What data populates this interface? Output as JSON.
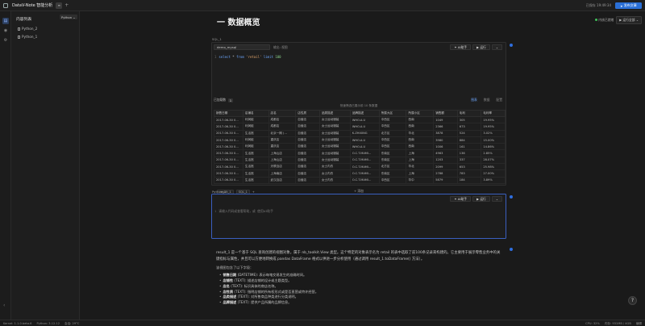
{
  "app": {
    "title": "DataV-Note 智能分析",
    "saved_text": "已保存 19:49:34",
    "publish_label": "发布文章",
    "tab_icon": "layers-icon"
  },
  "sidebar": {
    "title": "内容列表",
    "new_button": "Python",
    "items": [
      {
        "label": "Python_2"
      },
      {
        "label": "Python_1"
      }
    ]
  },
  "toolbar": {
    "kernel_status": "内核已就绪",
    "run_all": "运行全部"
  },
  "heading": {
    "text": "一 数据概览"
  },
  "sql_cell": {
    "label": "SQL_1",
    "db": "demo_mysql",
    "output_label": "输出: 视图",
    "ai_button": "AI助手",
    "run_button": "运行",
    "line_no": "1",
    "code": {
      "kw1": "select",
      "star": " * ",
      "kw2": "from",
      "table": " 'retail' ",
      "kw3": "limit",
      "limit": "100"
    },
    "result_label": "已加载数",
    "result_count": "1",
    "view_tabs": [
      "图表",
      "数据",
      "配置"
    ],
    "data_note": "快速筛选已展示前 10 条数据",
    "columns": [
      "销售日期",
      "店铺名",
      "店名",
      "店性质",
      "品类描述",
      "品牌描述",
      "所属大区",
      "所属小区",
      "销售额",
      "毛利",
      "毛利率"
    ],
    "rows": [
      [
        "2017-06-30 0...",
        "利润组",
        "成都店",
        "自营店",
        "女士运动服装",
        "WHO.A.U",
        "中西区",
        "西南",
        "1049",
        "305",
        "19.95%"
      ],
      [
        "2017-06-30 0...",
        "利润组",
        "成都店",
        "自营店",
        "女士运动服装",
        "WHO.A.U",
        "中西区",
        "西南",
        "2366",
        "673",
        "19.95%"
      ],
      [
        "2017-06-30 0...",
        "生活馆",
        "北京一期 (...",
        "自营店",
        "女士运动服装",
        "K.ZHIXING",
        "北方区",
        "华北",
        "3878",
        "524",
        "3.02%"
      ],
      [
        "2017-06-30 0...",
        "利润组",
        "重庆店",
        "自营店",
        "女士运动服装",
        "WHO.A.U",
        "中西区",
        "西南",
        "3980",
        "884",
        "15.00%"
      ],
      [
        "2017-06-30 0...",
        "利润组",
        "重庆店",
        "自营店",
        "女士运动服装",
        "WHO.A.U",
        "中西区",
        "西南",
        "1006",
        "161",
        "14.86%"
      ],
      [
        "2017-06-30 0...",
        "生活馆",
        "上海山店",
        "自营店",
        "女士运动服装",
        "O.C.T.MAMI...",
        "东南区",
        "上海",
        "4963",
        "136",
        "2.85%"
      ],
      [
        "2017-06-30 0...",
        "生活馆",
        "上海山店",
        "自营店",
        "女士运动服装",
        "O.C.T.MAMI...",
        "东南区",
        "上海",
        "1203",
        "337",
        "28.07%"
      ],
      [
        "2017-06-30 0...",
        "生活馆",
        "天联百店",
        "自营店",
        "女士内衣",
        "O.C.T.MAMI...",
        "北方区",
        "华北",
        "2099",
        "653",
        "25.98%"
      ],
      [
        "2017-06-30 0...",
        "生活馆",
        "上海南店",
        "自营店",
        "女士内衣",
        "O.C.T.MAMI...",
        "东南区",
        "上海",
        "2788",
        "783",
        "27.00%"
      ],
      [
        "2017-06-30 0...",
        "生活馆",
        "武汉百店",
        "自营店",
        "女士内衣",
        "O.C.T.MAMI...",
        "中西区",
        "华中",
        "5879",
        "184",
        "3.89%"
      ]
    ],
    "result_tabs": [
      "result_1",
      "SQL_1"
    ],
    "add_label": "+ 添加"
  },
  "python_cell": {
    "label": "Python_2",
    "ai_button": "AI助手",
    "run_button": "运行",
    "line_no": "1",
    "placeholder": "请输入代码或查看帮助，或 使用AI助手"
  },
  "markdown": {
    "para_a": "result_1 是一个基于 SQL 查询创建的视图对象，属于 nb_toolkit.View 类型。这个特定的对象表示名为 retail 的表中选取了前100条记录来构建的。它主要用于展示零售业务中的关键指标与属性，并且可以方便地转换成 pandas DataFrame 格式以供进一步分析使用（通过调用 result_1.toDataFrame() 方法）。",
    "sub": "该视图包含了以下字段：",
    "fields": [
      {
        "name": "销售日期",
        "desc": " (DATETIME): 表示每笔交易发生的准确时间。"
      },
      {
        "name": "店铺性",
        "desc": " (TEXT): 描述店铺的设计或主题类型。"
      },
      {
        "name": "店名",
        "desc": " (TEXT): 标识具体的商店名称。"
      },
      {
        "name": "店性质",
        "desc": " (TEXT): 指明店铺的所有权形式或是否直营或特许经营。"
      },
      {
        "name": "品类描述",
        "desc": " (TEXT): 对所售商品种类进行分类说明。"
      },
      {
        "name": "品牌描述",
        "desc": " (TEXT): 提供产品所属的品牌信息。"
      }
    ]
  },
  "status": {
    "kernel": "Kernel: 1.1.0.beta.6",
    "python": "Python: 3.12.12",
    "session": "会话: 29°C",
    "cpu": "CPU: 32%",
    "memory": "内存: 931MB / 4GB",
    "mode": "编辑"
  }
}
